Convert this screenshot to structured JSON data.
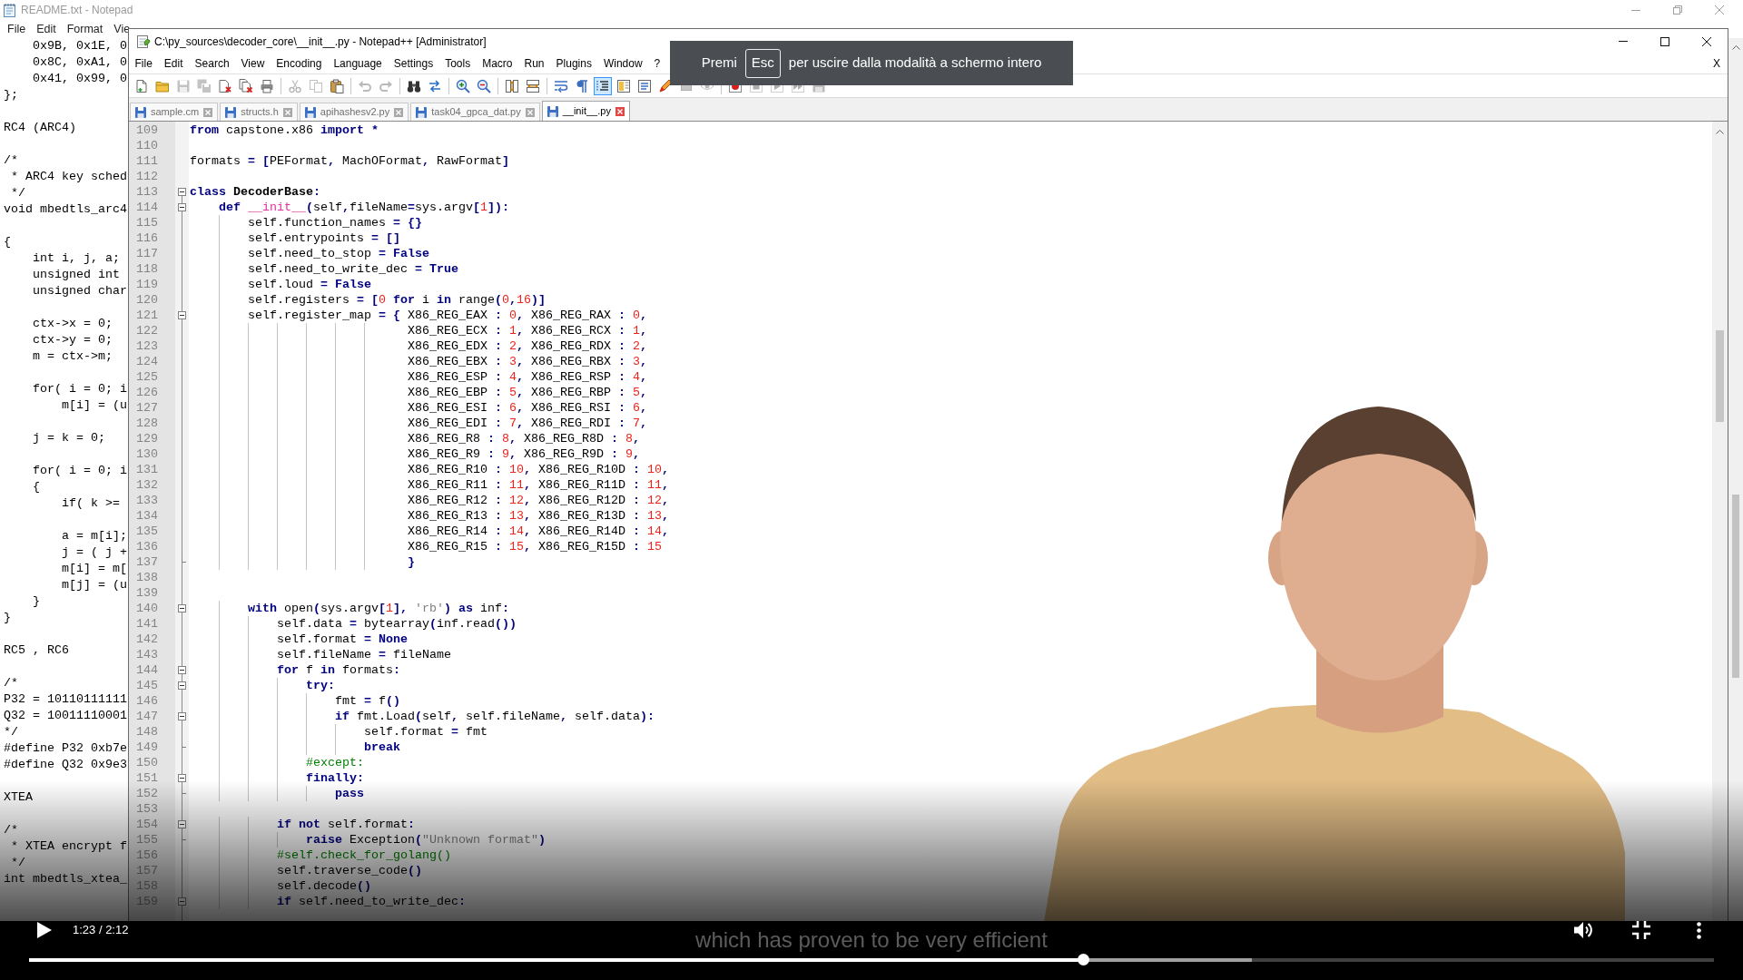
{
  "notepad": {
    "title": "README.txt - Notepad",
    "menu": [
      "File",
      "Edit",
      "Format",
      "Vie"
    ],
    "blocks": [
      [
        "    0x9B, 0x1E, 0",
        "    0x8C, 0xA1, 0",
        "    0x41, 0x99, 0",
        "};"
      ],
      [
        "RC4 (ARC4)"
      ],
      [
        "/*",
        " * ARC4 key sched",
        " */",
        "void mbedtls_arc4"
      ],
      [
        "{",
        "    int i, j, a;",
        "    unsigned int",
        "    unsigned char"
      ],
      [
        "    ctx->x = 0;",
        "    ctx->y = 0;",
        "    m = ctx->m;"
      ],
      [
        "    for( i = 0; i",
        "        m[i] = (u"
      ],
      [
        "    j = k = 0;"
      ],
      [
        "    for( i = 0; i",
        "    {",
        "        if( k >="
      ],
      [
        "        a = m[i];",
        "        j = ( j +",
        "        m[i] = m[",
        "        m[j] = (u",
        "    }",
        "}"
      ],
      [
        "RC5 , RC6"
      ],
      [
        "/*",
        "P32 = 10110111111",
        "Q32 = 10011110001",
        "*/",
        "#define P32 0xb7e",
        "#define Q32 0x9e3"
      ],
      [
        "XTEA"
      ],
      [
        "/*",
        " * XTEA encrypt f",
        " */",
        "int mbedtls_xtea_"
      ]
    ]
  },
  "notepadpp": {
    "title": "C:\\py_sources\\decoder_core\\__init__.py - Notepad++ [Administrator]",
    "menu": [
      "File",
      "Edit",
      "Search",
      "View",
      "Encoding",
      "Language",
      "Settings",
      "Tools",
      "Macro",
      "Run",
      "Plugins",
      "Window",
      "?"
    ],
    "menu_close": "X",
    "toolbar": [
      [
        {
          "kind": "new",
          "disabled": false,
          "pressed": false
        },
        {
          "kind": "open",
          "disabled": false,
          "pressed": false
        },
        {
          "kind": "save",
          "disabled": true,
          "pressed": false
        },
        {
          "kind": "saveall",
          "disabled": true,
          "pressed": false
        },
        {
          "kind": "close",
          "disabled": false,
          "pressed": false
        },
        {
          "kind": "closeall",
          "disabled": false,
          "pressed": false
        },
        {
          "kind": "print",
          "disabled": false,
          "pressed": false
        }
      ],
      [
        {
          "kind": "cut",
          "disabled": true,
          "pressed": false
        },
        {
          "kind": "copy",
          "disabled": true,
          "pressed": false
        },
        {
          "kind": "paste",
          "disabled": false,
          "pressed": false
        }
      ],
      [
        {
          "kind": "undo",
          "disabled": true,
          "pressed": false
        },
        {
          "kind": "redo",
          "disabled": true,
          "pressed": false
        }
      ],
      [
        {
          "kind": "find",
          "disabled": false,
          "pressed": false
        },
        {
          "kind": "replace",
          "disabled": false,
          "pressed": false
        }
      ],
      [
        {
          "kind": "zoomin",
          "disabled": false,
          "pressed": false
        },
        {
          "kind": "zoomout",
          "disabled": false,
          "pressed": false
        }
      ],
      [
        {
          "kind": "syncv",
          "disabled": false,
          "pressed": false
        },
        {
          "kind": "synch",
          "disabled": false,
          "pressed": false
        }
      ],
      [
        {
          "kind": "wrap",
          "disabled": false,
          "pressed": false
        },
        {
          "kind": "allchars",
          "disabled": false,
          "pressed": false
        },
        {
          "kind": "guides",
          "disabled": false,
          "pressed": true
        },
        {
          "kind": "map",
          "disabled": false,
          "pressed": false
        },
        {
          "kind": "list",
          "disabled": false,
          "pressed": false
        },
        {
          "kind": "pen",
          "disabled": false,
          "pressed": false
        },
        {
          "kind": "square",
          "disabled": true,
          "pressed": false
        },
        {
          "kind": "eye",
          "disabled": true,
          "pressed": false
        }
      ],
      [
        {
          "kind": "record",
          "disabled": false,
          "pressed": false
        },
        {
          "kind": "stop",
          "disabled": true,
          "pressed": false
        },
        {
          "kind": "play",
          "disabled": true,
          "pressed": false
        },
        {
          "kind": "repeat",
          "disabled": true,
          "pressed": false
        },
        {
          "kind": "savemacro",
          "disabled": true,
          "pressed": false
        }
      ]
    ],
    "tabs": [
      {
        "label": "sample.cm",
        "selected": false
      },
      {
        "label": "structs.h",
        "selected": false
      },
      {
        "label": "apihashesv2.py",
        "selected": false
      },
      {
        "label": "task04_gpca_dat.py",
        "selected": false
      },
      {
        "label": "__init__.py",
        "selected": true
      }
    ],
    "editor": {
      "lines": [
        {
          "number": "109",
          "tokens": [
            {
              "kind": "keyword",
              "text": "from"
            },
            {
              "kind": "plain",
              "text": " capstone.x86 "
            },
            {
              "kind": "keyword",
              "text": "import"
            },
            {
              "kind": "plain",
              "text": " *"
            }
          ]
        },
        {
          "number": "110"
        },
        {
          "number": "111",
          "tokens": [
            {
              "kind": "plain",
              "text": "formats = [PEFormat, MachOFormat, RawFormat]"
            }
          ]
        },
        {
          "number": "112"
        },
        {
          "number": "113",
          "fold": {
            "kind": "box",
            "expanded": true
          },
          "tokens": [
            {
              "kind": "keyword",
              "text": "class"
            },
            {
              "kind": "classname",
              "text": " DecoderBase"
            },
            {
              "kind": "plain",
              "text": ":"
            }
          ]
        },
        {
          "number": "114",
          "fold": {
            "kind": "box",
            "expanded": true
          },
          "tokens": [
            {
              "kind": "keyword",
              "text": "    def"
            },
            {
              "kind": "function",
              "text": " __init__"
            },
            {
              "kind": "plain",
              "text": "(self,fileName=sys.argv["
            },
            {
              "kind": "number",
              "text": "1"
            },
            {
              "kind": "plain",
              "text": "]):"
            }
          ]
        },
        {
          "number": "115",
          "tokens": [
            {
              "kind": "plain",
              "text": "        self.function_names = {}"
            }
          ]
        },
        {
          "number": "116",
          "tokens": [
            {
              "kind": "plain",
              "text": "        self.entrypoints = []"
            }
          ]
        },
        {
          "number": "117",
          "tokens": [
            {
              "kind": "plain",
              "text": "        self.need_to_stop = "
            },
            {
              "kind": "keyword",
              "text": "False"
            }
          ]
        },
        {
          "number": "118",
          "tokens": [
            {
              "kind": "plain",
              "text": "        self.need_to_write_dec = "
            },
            {
              "kind": "keyword",
              "text": "True"
            }
          ]
        },
        {
          "number": "119",
          "tokens": [
            {
              "kind": "plain",
              "text": "        self.loud = "
            },
            {
              "kind": "keyword",
              "text": "False"
            }
          ]
        },
        {
          "number": "120",
          "tokens": [
            {
              "kind": "plain",
              "text": "        self.registers = ["
            },
            {
              "kind": "number",
              "text": "0"
            },
            {
              "kind": "keyword",
              "text": " for"
            },
            {
              "kind": "plain",
              "text": " i "
            },
            {
              "kind": "keyword",
              "text": "in"
            },
            {
              "kind": "plain",
              "text": " range("
            },
            {
              "kind": "number",
              "text": "0"
            },
            {
              "kind": "plain",
              "text": ","
            },
            {
              "kind": "number",
              "text": "16"
            },
            {
              "kind": "plain",
              "text": ")]"
            }
          ]
        },
        {
          "number": "121",
          "fold": {
            "kind": "box",
            "expanded": true
          },
          "tokens": [
            {
              "kind": "plain",
              "text": "        self.register_map = { X86_REG_EAX : "
            },
            {
              "kind": "number",
              "text": "0"
            },
            {
              "kind": "plain",
              "text": ", X86_REG_RAX : "
            },
            {
              "kind": "number",
              "text": "0"
            },
            {
              "kind": "plain",
              "text": ","
            }
          ]
        },
        {
          "number": "122",
          "tokens": [
            {
              "kind": "plain",
              "text": "                              X86_REG_ECX : "
            },
            {
              "kind": "number",
              "text": "1"
            },
            {
              "kind": "plain",
              "text": ", X86_REG_RCX : "
            },
            {
              "kind": "number",
              "text": "1"
            },
            {
              "kind": "plain",
              "text": ","
            }
          ]
        },
        {
          "number": "123",
          "tokens": [
            {
              "kind": "plain",
              "text": "                              X86_REG_EDX : "
            },
            {
              "kind": "number",
              "text": "2"
            },
            {
              "kind": "plain",
              "text": ", X86_REG_RDX : "
            },
            {
              "kind": "number",
              "text": "2"
            },
            {
              "kind": "plain",
              "text": ","
            }
          ]
        },
        {
          "number": "124",
          "tokens": [
            {
              "kind": "plain",
              "text": "                              X86_REG_EBX : "
            },
            {
              "kind": "number",
              "text": "3"
            },
            {
              "kind": "plain",
              "text": ", X86_REG_RBX : "
            },
            {
              "kind": "number",
              "text": "3"
            },
            {
              "kind": "plain",
              "text": ","
            }
          ]
        },
        {
          "number": "125",
          "tokens": [
            {
              "kind": "plain",
              "text": "                              X86_REG_ESP : "
            },
            {
              "kind": "number",
              "text": "4"
            },
            {
              "kind": "plain",
              "text": ", X86_REG_RSP : "
            },
            {
              "kind": "number",
              "text": "4"
            },
            {
              "kind": "plain",
              "text": ","
            }
          ]
        },
        {
          "number": "126",
          "tokens": [
            {
              "kind": "plain",
              "text": "                              X86_REG_EBP : "
            },
            {
              "kind": "number",
              "text": "5"
            },
            {
              "kind": "plain",
              "text": ", X86_REG_RBP : "
            },
            {
              "kind": "number",
              "text": "5"
            },
            {
              "kind": "plain",
              "text": ","
            }
          ]
        },
        {
          "number": "127",
          "tokens": [
            {
              "kind": "plain",
              "text": "                              X86_REG_ESI : "
            },
            {
              "kind": "number",
              "text": "6"
            },
            {
              "kind": "plain",
              "text": ", X86_REG_RSI : "
            },
            {
              "kind": "number",
              "text": "6"
            },
            {
              "kind": "plain",
              "text": ","
            }
          ]
        },
        {
          "number": "128",
          "tokens": [
            {
              "kind": "plain",
              "text": "                              X86_REG_EDI : "
            },
            {
              "kind": "number",
              "text": "7"
            },
            {
              "kind": "plain",
              "text": ", X86_REG_RDI : "
            },
            {
              "kind": "number",
              "text": "7"
            },
            {
              "kind": "plain",
              "text": ","
            }
          ]
        },
        {
          "number": "129",
          "tokens": [
            {
              "kind": "plain",
              "text": "                              X86_REG_R8 : "
            },
            {
              "kind": "number",
              "text": "8"
            },
            {
              "kind": "plain",
              "text": ", X86_REG_R8D : "
            },
            {
              "kind": "number",
              "text": "8"
            },
            {
              "kind": "plain",
              "text": ","
            }
          ]
        },
        {
          "number": "130",
          "tokens": [
            {
              "kind": "plain",
              "text": "                              X86_REG_R9 : "
            },
            {
              "kind": "number",
              "text": "9"
            },
            {
              "kind": "plain",
              "text": ", X86_REG_R9D : "
            },
            {
              "kind": "number",
              "text": "9"
            },
            {
              "kind": "plain",
              "text": ","
            }
          ]
        },
        {
          "number": "131",
          "tokens": [
            {
              "kind": "plain",
              "text": "                              X86_REG_R10 : "
            },
            {
              "kind": "number",
              "text": "10"
            },
            {
              "kind": "plain",
              "text": ", X86_REG_R10D : "
            },
            {
              "kind": "number",
              "text": "10"
            },
            {
              "kind": "plain",
              "text": ","
            }
          ]
        },
        {
          "number": "132",
          "tokens": [
            {
              "kind": "plain",
              "text": "                              X86_REG_R11 : "
            },
            {
              "kind": "number",
              "text": "11"
            },
            {
              "kind": "plain",
              "text": ", X86_REG_R11D : "
            },
            {
              "kind": "number",
              "text": "11"
            },
            {
              "kind": "plain",
              "text": ","
            }
          ]
        },
        {
          "number": "133",
          "tokens": [
            {
              "kind": "plain",
              "text": "                              X86_REG_R12 : "
            },
            {
              "kind": "number",
              "text": "12"
            },
            {
              "kind": "plain",
              "text": ", X86_REG_R12D : "
            },
            {
              "kind": "number",
              "text": "12"
            },
            {
              "kind": "plain",
              "text": ","
            }
          ]
        },
        {
          "number": "134",
          "tokens": [
            {
              "kind": "plain",
              "text": "                              X86_REG_R13 : "
            },
            {
              "kind": "number",
              "text": "13"
            },
            {
              "kind": "plain",
              "text": ", X86_REG_R13D : "
            },
            {
              "kind": "number",
              "text": "13"
            },
            {
              "kind": "plain",
              "text": ","
            }
          ]
        },
        {
          "number": "135",
          "tokens": [
            {
              "kind": "plain",
              "text": "                              X86_REG_R14 : "
            },
            {
              "kind": "number",
              "text": "14"
            },
            {
              "kind": "plain",
              "text": ", X86_REG_R14D : "
            },
            {
              "kind": "number",
              "text": "14"
            },
            {
              "kind": "plain",
              "text": ","
            }
          ]
        },
        {
          "number": "136",
          "tokens": [
            {
              "kind": "plain",
              "text": "                              X86_REG_R15 : "
            },
            {
              "kind": "number",
              "text": "15"
            },
            {
              "kind": "plain",
              "text": ", X86_REG_R15D : "
            },
            {
              "kind": "number",
              "text": "15"
            }
          ]
        },
        {
          "number": "137",
          "fold": {
            "kind": "end"
          },
          "tokens": [
            {
              "kind": "plain",
              "text": "                              }"
            }
          ]
        },
        {
          "number": "138"
        },
        {
          "number": "139"
        },
        {
          "number": "140",
          "fold": {
            "kind": "box",
            "expanded": true
          },
          "tokens": [
            {
              "kind": "keyword",
              "text": "        with"
            },
            {
              "kind": "plain",
              "text": " open(sys.argv["
            },
            {
              "kind": "number",
              "text": "1"
            },
            {
              "kind": "plain",
              "text": "], "
            },
            {
              "kind": "string",
              "text": "'rb'"
            },
            {
              "kind": "plain",
              "text": ") "
            },
            {
              "kind": "keyword",
              "text": "as"
            },
            {
              "kind": "plain",
              "text": " inf:"
            }
          ]
        },
        {
          "number": "141",
          "tokens": [
            {
              "kind": "plain",
              "text": "            self.data = bytearray(inf.read())"
            }
          ]
        },
        {
          "number": "142",
          "tokens": [
            {
              "kind": "plain",
              "text": "            self.format = "
            },
            {
              "kind": "keyword",
              "text": "None"
            }
          ]
        },
        {
          "number": "143",
          "tokens": [
            {
              "kind": "plain",
              "text": "            self.fileName = fileName"
            }
          ]
        },
        {
          "number": "144",
          "fold": {
            "kind": "box",
            "expanded": true
          },
          "tokens": [
            {
              "kind": "keyword",
              "text": "            for"
            },
            {
              "kind": "plain",
              "text": " f "
            },
            {
              "kind": "keyword",
              "text": "in"
            },
            {
              "kind": "plain",
              "text": " formats:"
            }
          ]
        },
        {
          "number": "145",
          "fold": {
            "kind": "box",
            "expanded": true
          },
          "tokens": [
            {
              "kind": "keyword",
              "text": "                try"
            },
            {
              "kind": "plain",
              "text": ":"
            }
          ]
        },
        {
          "number": "146",
          "tokens": [
            {
              "kind": "plain",
              "text": "                    fmt = f()"
            }
          ]
        },
        {
          "number": "147",
          "fold": {
            "kind": "box",
            "expanded": true
          },
          "tokens": [
            {
              "kind": "keyword",
              "text": "                    if"
            },
            {
              "kind": "plain",
              "text": " fmt.Load(self, self.fileName, self.data):"
            }
          ]
        },
        {
          "number": "148",
          "tokens": [
            {
              "kind": "plain",
              "text": "                        self.format = fmt"
            }
          ]
        },
        {
          "number": "149",
          "fold": {
            "kind": "end"
          },
          "tokens": [
            {
              "kind": "keyword",
              "text": "                        break"
            }
          ]
        },
        {
          "number": "150",
          "tokens": [
            {
              "kind": "comment",
              "text": "                #except:"
            }
          ]
        },
        {
          "number": "151",
          "fold": {
            "kind": "box",
            "expanded": true
          },
          "tokens": [
            {
              "kind": "keyword",
              "text": "                finally"
            },
            {
              "kind": "plain",
              "text": ":"
            }
          ]
        },
        {
          "number": "152",
          "fold": {
            "kind": "end"
          },
          "tokens": [
            {
              "kind": "keyword",
              "text": "                    pass"
            }
          ]
        },
        {
          "number": "153"
        },
        {
          "number": "154",
          "fold": {
            "kind": "box",
            "expanded": true
          },
          "tokens": [
            {
              "kind": "keyword",
              "text": "            if not"
            },
            {
              "kind": "plain",
              "text": " self.format:"
            }
          ]
        },
        {
          "number": "155",
          "fold": {
            "kind": "end"
          },
          "tokens": [
            {
              "kind": "keyword",
              "text": "                raise"
            },
            {
              "kind": "plain",
              "text": " Exception("
            },
            {
              "kind": "string",
              "text": "\"Unknown format\""
            },
            {
              "kind": "plain",
              "text": ")"
            }
          ]
        },
        {
          "number": "156",
          "tokens": [
            {
              "kind": "comment",
              "text": "            #self.check_for_golang()"
            }
          ]
        },
        {
          "number": "157",
          "tokens": [
            {
              "kind": "plain",
              "text": "            self.traverse_code()"
            }
          ]
        },
        {
          "number": "158",
          "tokens": [
            {
              "kind": "plain",
              "text": "            self.decode()"
            }
          ]
        },
        {
          "number": "159",
          "fold": {
            "kind": "box",
            "expanded": true
          },
          "tokens": [
            {
              "kind": "keyword",
              "text": "            if"
            },
            {
              "kind": "plain",
              "text": " self.need_to_write_dec:"
            }
          ]
        }
      ]
    }
  },
  "fullscreen_notice": {
    "before": "Premi",
    "key": "Esc",
    "after": "per uscire dalla modalità a schermo intero"
  },
  "player": {
    "time": "1:23 / 2:12",
    "caption": "which has proven to be very efficient",
    "progress": {
      "level": 0.626,
      "buffered": {
        "level": 0.726
      }
    }
  }
}
